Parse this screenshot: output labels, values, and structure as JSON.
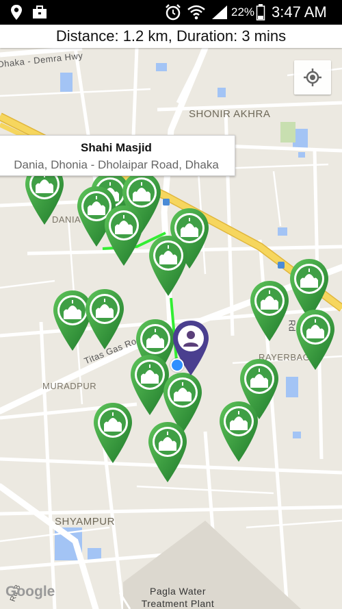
{
  "status_bar": {
    "left_icons": [
      "location-pin-icon",
      "briefcase-icon"
    ],
    "right_icons": [
      "alarm-icon",
      "wifi-icon",
      "signal-icon",
      "battery-icon"
    ],
    "battery_percent": "22%",
    "time": "3:47 AM"
  },
  "route_info": {
    "text": "Distance: 1.2 km, Duration: 3 mins"
  },
  "callout": {
    "title": "Shahi Masjid",
    "subtitle": "Dania, Dhonia - Dholaipar Road, Dhaka"
  },
  "map": {
    "road_labels": {
      "demra_hwy": "Dhaka - Demra Hwy",
      "titas_gas": "Titas Gas Road",
      "rd_small": "Rd",
      "rd_bottom": "Rd 8"
    },
    "area_labels": {
      "shonir_akhra": "SHONIR AKHRA",
      "dania": "DANIA",
      "rayerbag": "RAYERBAG",
      "muradpur": "MURADPUR",
      "shyampur": "SHYAMPUR"
    },
    "poi": {
      "pagla_line1": "Pagla Water",
      "pagla_line2": "Treatment Plant"
    },
    "attribution": "Google",
    "colors": {
      "land": "#ece9e1",
      "road": "#ffffff",
      "highway": "#f6d65e",
      "water": "#a3c4f5",
      "park": "#c8dfb0",
      "route": "#33ee33",
      "marker_green": "#2e9e3a",
      "user_marker": "#4a3f8f"
    }
  }
}
